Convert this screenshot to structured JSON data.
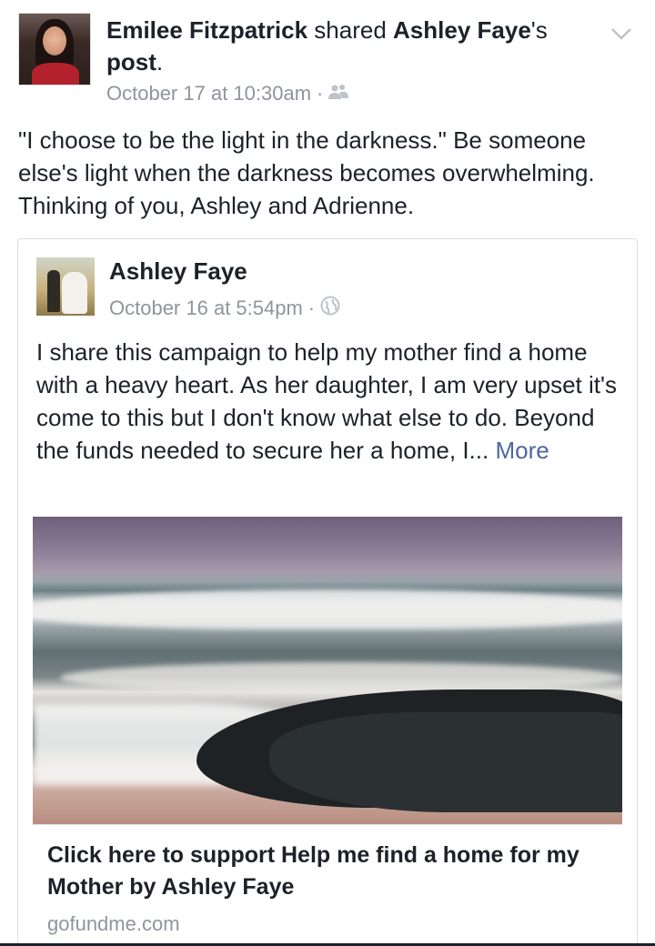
{
  "post": {
    "author": "Emilee Fitzpatrick",
    "action": " shared ",
    "shared_from": "Ashley Faye",
    "possessive": "'s",
    "object": "post",
    "period": ".",
    "timestamp": "October 17 at 10:30am",
    "meta_separator": "·",
    "audience_icon": "friends-icon",
    "menu_icon": "chevron-down-icon",
    "text": "\"I choose to be the light in the darkness.\" Be someone else's light when the darkness becomes overwhelming. Thinking of you, Ashley and Adrienne."
  },
  "shared_post": {
    "author": "Ashley Faye",
    "timestamp": "October 16 at 5:54pm",
    "meta_separator": "·",
    "audience_icon": "globe-icon",
    "text": "I share this campaign to help my mother find a home with a heavy heart. As her daughter, I am very upset it's come to this but I don't know what else to do. Beyond the funds needed to secure her a home, I...",
    "more_label": "More",
    "link": {
      "title": "Click here to support Help me find a home for my Mother by Ashley Faye",
      "domain": "gofundme.com"
    }
  },
  "colors": {
    "text": "#1d2129",
    "meta": "#90949c",
    "link": "#4b67a1",
    "border": "#dddfe2"
  }
}
